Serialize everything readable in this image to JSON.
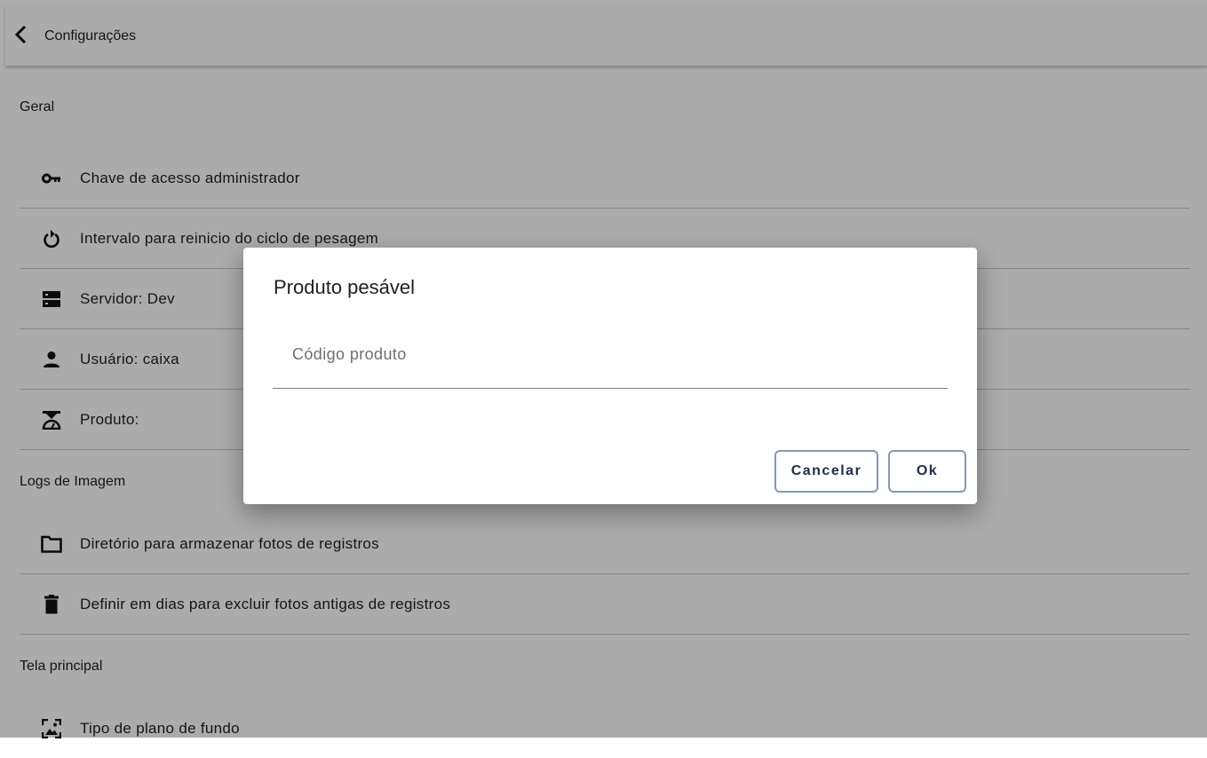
{
  "appbar": {
    "title": "Configurações",
    "back_icon": "chevron-left-icon"
  },
  "sections": {
    "geral": "Geral",
    "logs": "Logs de Imagem",
    "tela": "Tela principal"
  },
  "items": {
    "chave": {
      "label": "Chave de acesso administrador",
      "icon": "key-icon"
    },
    "intervalo": {
      "label": "Intervalo para reinicio do ciclo de pesagem",
      "icon": "restart-icon"
    },
    "servidor": {
      "label": "Servidor: Dev",
      "icon": "server-icon"
    },
    "usuario": {
      "label": "Usuário: caixa",
      "icon": "person-icon"
    },
    "produto": {
      "label": "Produto:",
      "icon": "scale-icon"
    },
    "diretorio": {
      "label": "Diretório para armazenar fotos de registros",
      "icon": "folder-icon"
    },
    "excluir": {
      "label": "Definir em dias para excluir fotos antigas de registros",
      "icon": "trash-icon"
    },
    "fundo": {
      "label": "Tipo de plano de fundo",
      "icon": "wallpaper-icon"
    }
  },
  "dialog": {
    "title": "Produto pesável",
    "input_placeholder": "Código produto",
    "input_value": "",
    "cancel_label": "Cancelar",
    "ok_label": "Ok"
  },
  "colors": {
    "button_border": "#8797b3",
    "button_text": "#1d2b4f",
    "scrim": "rgba(0,0,0,0.33)"
  }
}
